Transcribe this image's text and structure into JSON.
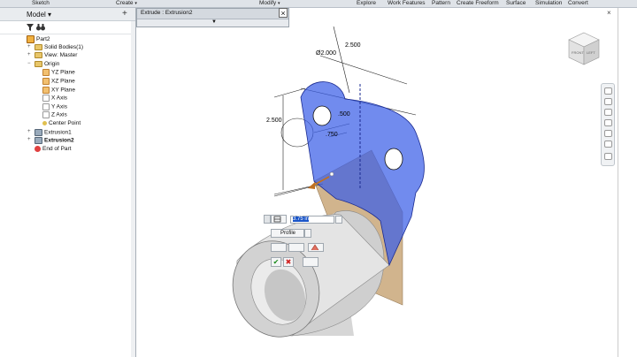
{
  "ribbon": {
    "tabs": [
      "Sketch",
      "Create",
      "Modify",
      "Explore",
      "Work Features",
      "Pattern",
      "Create Freeform",
      "Surface",
      "Simulation",
      "Convert"
    ],
    "dropdown_arrow": "▾"
  },
  "browser": {
    "title": "Model",
    "plus": "+",
    "tree": [
      {
        "label": "Part2",
        "icon": "part-icon",
        "indent": 0,
        "exp": ""
      },
      {
        "label": "Solid Bodies(1)",
        "icon": "folder-icon",
        "indent": 1,
        "exp": "+"
      },
      {
        "label": "View: Master",
        "icon": "folder-icon",
        "indent": 1,
        "exp": "+"
      },
      {
        "label": "Origin",
        "icon": "folder-icon",
        "indent": 1,
        "exp": "−"
      },
      {
        "label": "YZ Plane",
        "icon": "plane-icon",
        "indent": 2,
        "exp": ""
      },
      {
        "label": "XZ Plane",
        "icon": "plane-icon",
        "indent": 2,
        "exp": ""
      },
      {
        "label": "XY Plane",
        "icon": "plane-icon",
        "indent": 2,
        "exp": ""
      },
      {
        "label": "X Axis",
        "icon": "axis-icon",
        "indent": 2,
        "exp": ""
      },
      {
        "label": "Y Axis",
        "icon": "axis-icon",
        "indent": 2,
        "exp": ""
      },
      {
        "label": "Z Axis",
        "icon": "axis-icon",
        "indent": 2,
        "exp": ""
      },
      {
        "label": "Center Point",
        "icon": "point-icon",
        "indent": 2,
        "exp": ""
      },
      {
        "label": "Extrusion1",
        "icon": "extrusion-icon",
        "indent": 1,
        "exp": "+"
      },
      {
        "label": "Extrusion2",
        "icon": "extrusion-icon",
        "indent": 1,
        "exp": "+",
        "bold": true
      },
      {
        "label": "End of Part",
        "icon": "end-of-part-icon",
        "indent": 1,
        "exp": ""
      }
    ]
  },
  "dialog": {
    "title": "Extrude : Extrusion2",
    "close": "×",
    "expand": "▼"
  },
  "minitoolbar": {
    "distance_value": "3.75 in",
    "profile_label": "Profile",
    "ok": "✔",
    "cancel": "✖"
  },
  "dimensions": {
    "d1": "2.500",
    "d2": "Ø2.000",
    "d3": "2.500",
    "d4": ".500",
    "d5": ".750"
  },
  "colors": {
    "profile_fill": "#3a5ee8",
    "extrude_preview": "#c9a77a",
    "ribbon_bg": "#dfe3e8"
  },
  "viewcube": {
    "faces": [
      "FRONT",
      "LEFT"
    ]
  }
}
